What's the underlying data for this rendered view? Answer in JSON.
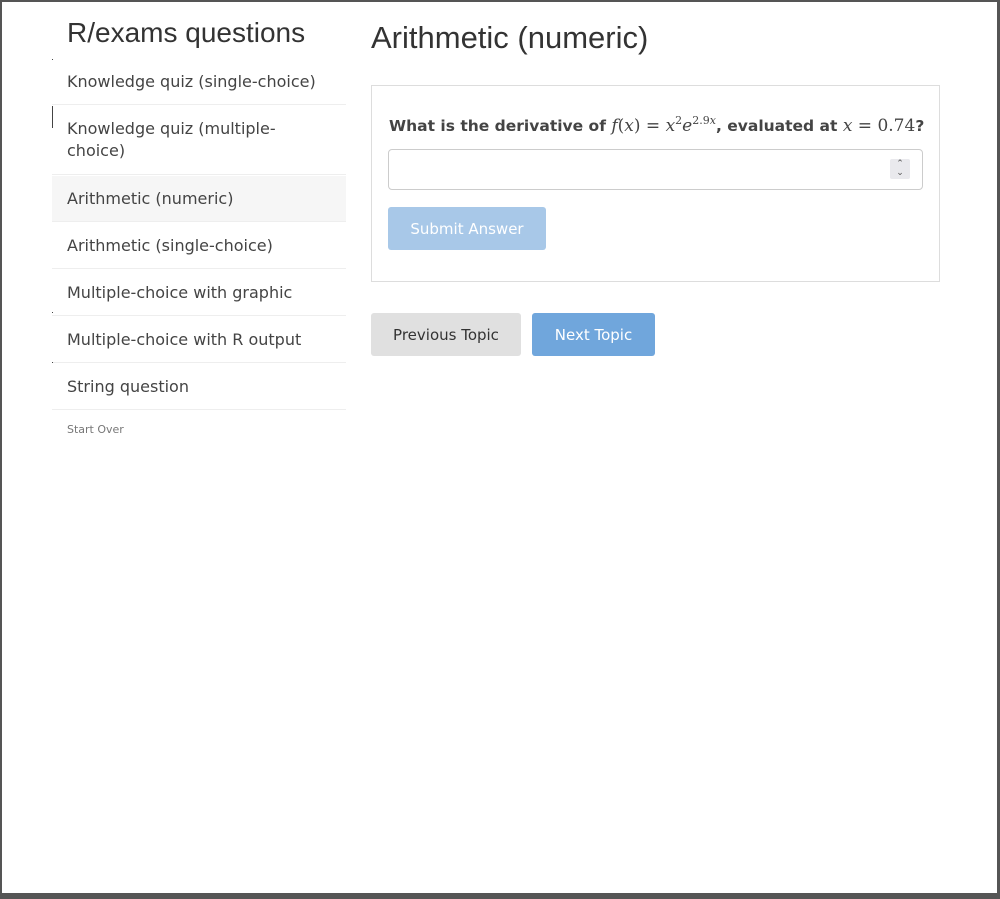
{
  "sidebar": {
    "title": "R/exams questions",
    "items": [
      {
        "label": "Knowledge quiz (single-choice)"
      },
      {
        "label": "Knowledge quiz (multiple-choice)"
      },
      {
        "label": "Arithmetic (numeric)"
      },
      {
        "label": "Arithmetic (single-choice)"
      },
      {
        "label": "Multiple-choice with graphic"
      },
      {
        "label": "Multiple-choice with R output"
      },
      {
        "label": "String question"
      }
    ],
    "active_index": 2,
    "start_over": "Start Over"
  },
  "main": {
    "title": "Arithmetic (numeric)",
    "question": {
      "prefix": "What is the derivative of",
      "function": "f(x) = x²e^(2.9x)",
      "middle": ", evaluated at",
      "point": "x = 0.74",
      "suffix": "?"
    },
    "answer": {
      "value": "",
      "placeholder": ""
    },
    "submit_label": "Submit Answer",
    "previous_label": "Previous Topic",
    "next_label": "Next Topic"
  },
  "colors": {
    "submit_disabled": "#a8c8e8",
    "next_button": "#70a6dc",
    "previous_button": "#e0e0e0",
    "active_item": "#f6f6f6"
  }
}
